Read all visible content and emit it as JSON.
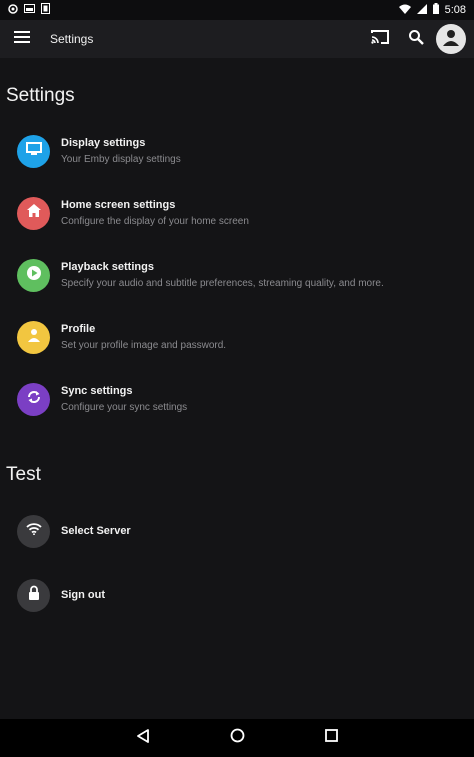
{
  "status_bar": {
    "time": "5:08"
  },
  "app_bar": {
    "title": "Settings"
  },
  "sections": [
    {
      "title": "Settings",
      "items": [
        {
          "title": "Display settings",
          "subtitle": "Your Emby display settings",
          "icon": "monitor-icon",
          "color": "#1ea2e8"
        },
        {
          "title": "Home screen settings",
          "subtitle": "Configure the display of your home screen",
          "icon": "home-icon",
          "color": "#e05a5a"
        },
        {
          "title": "Playback settings",
          "subtitle": "Specify your audio and subtitle preferences, streaming quality, and more.",
          "icon": "play-circle-icon",
          "color": "#5fbf5f"
        },
        {
          "title": "Profile",
          "subtitle": "Set your profile image and password.",
          "icon": "person-icon",
          "color": "#f2c640"
        },
        {
          "title": "Sync settings",
          "subtitle": "Configure your sync settings",
          "icon": "sync-icon",
          "color": "#7b3fc4"
        }
      ]
    },
    {
      "title": "Test",
      "items": [
        {
          "title": "Select Server",
          "icon": "wifi-icon",
          "color": "#3a3a3d"
        },
        {
          "title": "Sign out",
          "icon": "lock-icon",
          "color": "#3a3a3d"
        }
      ]
    }
  ]
}
